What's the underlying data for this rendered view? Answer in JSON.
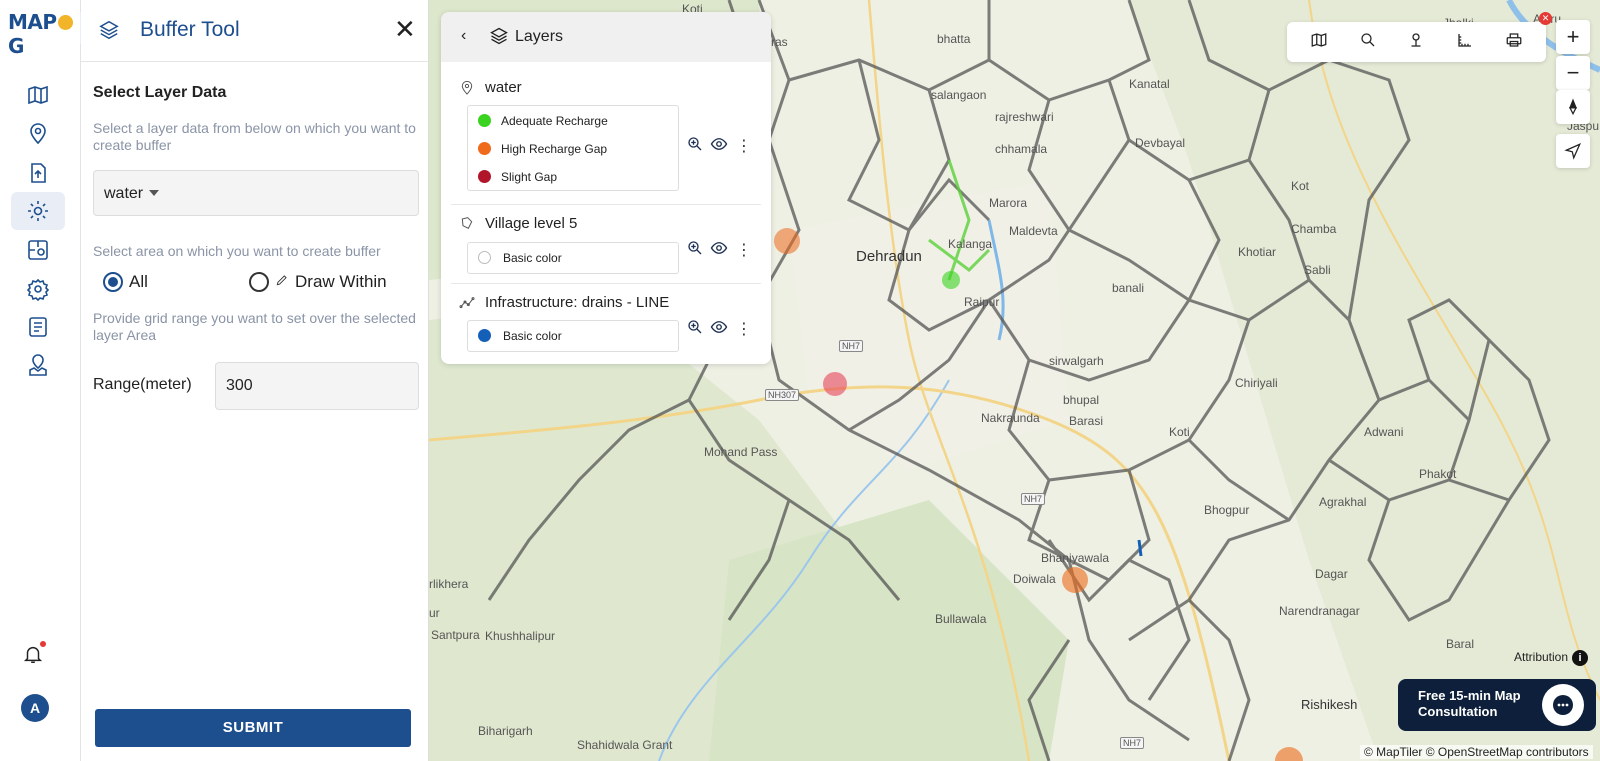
{
  "app": {
    "logo": "MAPOG"
  },
  "rail": {
    "icons": [
      "map-icon",
      "location-pin-icon",
      "file-upload-icon",
      "gear-icon",
      "analysis-icon",
      "settings-icon",
      "report-icon",
      "map-pin-icon"
    ],
    "active": "gear-icon",
    "avatar_letter": "A"
  },
  "panel": {
    "title": "Buffer Tool",
    "section_title": "Select Layer Data",
    "layer_helper": "Select a layer data from below on which you want to create buffer",
    "selected_layer": "water",
    "area_helper": "Select area on which you want to create buffer",
    "radio_all": "All",
    "radio_draw": "Draw Within",
    "range_helper": "Provide grid range you want to set over the selected layer Area",
    "range_label": "Range(meter)",
    "range_value": "300",
    "submit": "SUBMIT"
  },
  "layers_panel": {
    "title": "Layers",
    "layers": [
      {
        "name": "water",
        "legend": [
          {
            "label": "Adequate Recharge",
            "color": "#3ad31f"
          },
          {
            "label": "High Recharge Gap",
            "color": "#ef6a1b"
          },
          {
            "label": "Slight Gap",
            "color": "#b0152a"
          }
        ]
      },
      {
        "name": "Village level 5",
        "legend": [
          {
            "label": "Basic color",
            "color": "#ffffff"
          }
        ]
      },
      {
        "name": "Infrastructure: drains - LINE",
        "legend": [
          {
            "label": "Basic color",
            "color": "#1460b8"
          }
        ]
      }
    ]
  },
  "map": {
    "places": [
      {
        "name": "Koti"
      },
      {
        "name": "astras"
      },
      {
        "name": "bhatta"
      },
      {
        "name": "Jhalki"
      },
      {
        "name": "Aleru"
      },
      {
        "name": "Kanatal"
      },
      {
        "name": "salangaon"
      },
      {
        "name": "rajreshwari"
      },
      {
        "name": "chhamala"
      },
      {
        "name": "Devbayal"
      },
      {
        "name": "Jaspu"
      },
      {
        "name": "Marora"
      },
      {
        "name": "Kot"
      },
      {
        "name": "Chamba"
      },
      {
        "name": "Kalanga"
      },
      {
        "name": "Maldevta"
      },
      {
        "name": "Dehradun"
      },
      {
        "name": "Khotiar"
      },
      {
        "name": "Sabli"
      },
      {
        "name": "Raipur"
      },
      {
        "name": "banali"
      },
      {
        "name": "sirwalgarh"
      },
      {
        "name": "bhupal"
      },
      {
        "name": "Chiriyali"
      },
      {
        "name": "Barasi"
      },
      {
        "name": "Nakraunda"
      },
      {
        "name": "Koti"
      },
      {
        "name": "Adwani"
      },
      {
        "name": "Mohand Pass"
      },
      {
        "name": "Phakot"
      },
      {
        "name": "Agrakhal"
      },
      {
        "name": "Bhogpur"
      },
      {
        "name": "Bhaniyawala"
      },
      {
        "name": "Dagar"
      },
      {
        "name": "Doiwala"
      },
      {
        "name": "rlikhera"
      },
      {
        "name": "Narendranagar"
      },
      {
        "name": "ur"
      },
      {
        "name": "Bullawala"
      },
      {
        "name": "Santpura"
      },
      {
        "name": "Khushhalipur"
      },
      {
        "name": "Baral"
      },
      {
        "name": "Rishikesh"
      },
      {
        "name": "Biharigarh"
      },
      {
        "name": "Shahidwala Grant"
      }
    ],
    "shields": [
      "NH7",
      "NH307",
      "NH7",
      "NH7"
    ],
    "attribution_label": "Attribution",
    "credits": "© MapTiler © OpenStreetMap contributors",
    "consult_text": "Free 15-min Map Consultation"
  },
  "toolbar": {
    "icons": [
      "basemap-icon",
      "search-icon",
      "person-pin-icon",
      "measure-icon",
      "print-icon"
    ]
  }
}
